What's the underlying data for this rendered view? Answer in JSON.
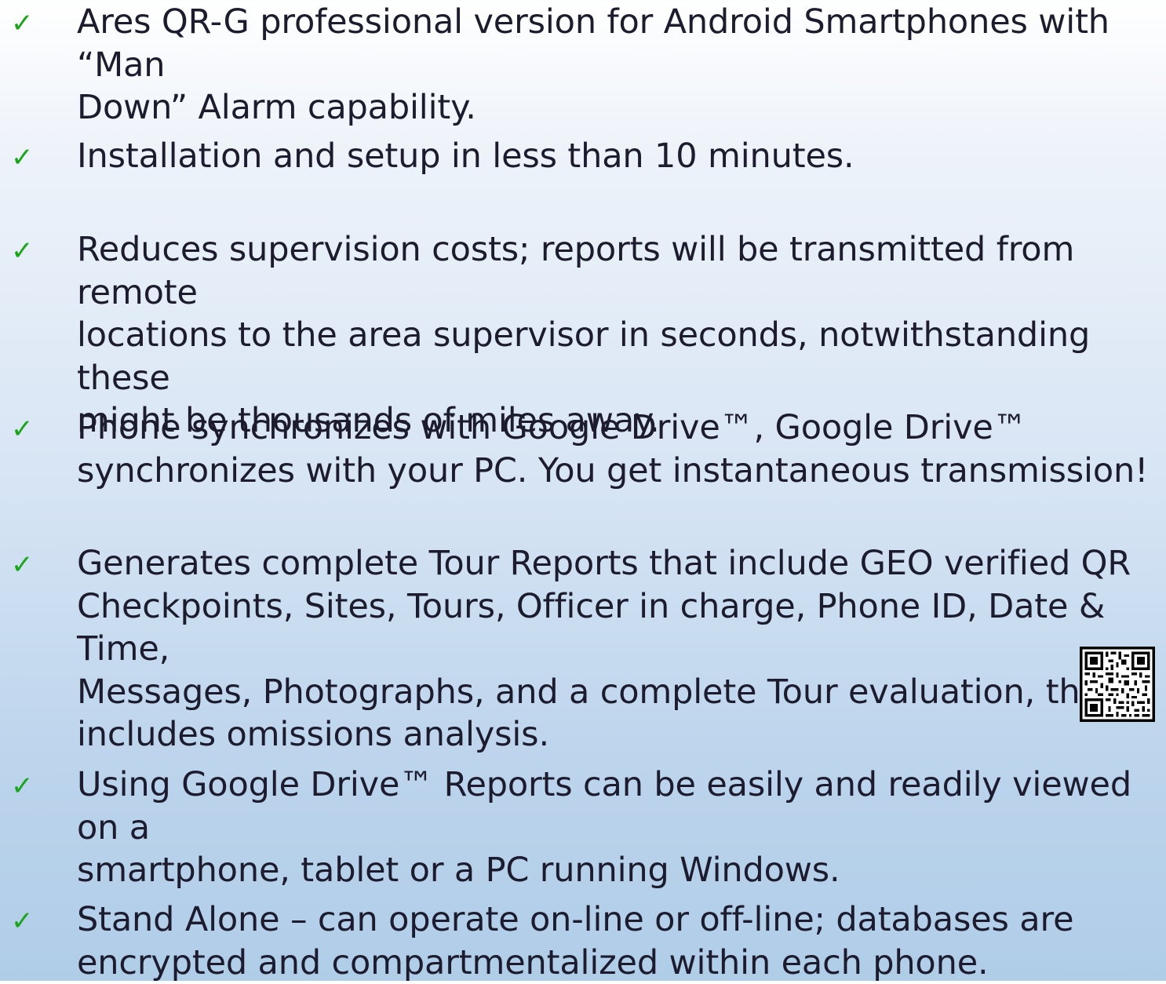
{
  "items": [
    {
      "text": "Ares QR-G professional version for Android Smartphones with “Man\nDown” Alarm capability."
    },
    {
      "text": "Installation and setup in less than 10 minutes."
    },
    {
      "text": "Reduces supervision costs; reports will be transmitted from remote\nlocations to the area supervisor in seconds, notwithstanding these\nmight be thousands of miles away."
    },
    {
      "text": "Phone synchronizes with Google Drive™, Google Drive™\nsynchronizes with your PC. You get instantaneous transmission!"
    },
    {
      "text": "Generates complete Tour Reports that include GEO verified QR\nCheckpoints, Sites, Tours, Officer in charge, Phone ID, Date & Time,\nMessages, Photographs, and a complete Tour evaluation, that\nincludes omissions analysis."
    },
    {
      "text": "Using Google Drive™ Reports can be easily and readily viewed on a\nsmartphone, tablet or a PC running Windows."
    },
    {
      "text": "Stand Alone – can operate on-line or off-line; databases are\nencrypted and compartmentalized within each phone."
    }
  ],
  "bullet_glyph": "✓",
  "colors": {
    "check": "#1aa51a",
    "text": "#1c1c2e",
    "background_top": "#ffffff",
    "background_bottom": "#b0cde8"
  },
  "qr_icon": "qr-code-icon"
}
